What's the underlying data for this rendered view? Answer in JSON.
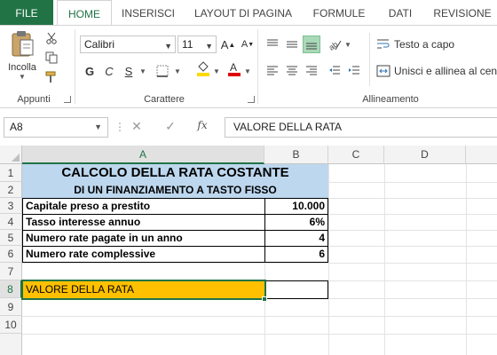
{
  "ribbon": {
    "tabs": [
      "FILE",
      "HOME",
      "INSERISCI",
      "LAYOUT DI PAGINA",
      "FORMULE",
      "DATI",
      "REVISIONE"
    ],
    "clipboard": {
      "paste_label": "Incolla",
      "group_label": "Appunti"
    },
    "font": {
      "name": "Calibri",
      "size": "11",
      "group_label": "Carattere",
      "bold": "G",
      "italic": "C",
      "underline": "S",
      "grow": "A",
      "shrink": "A"
    },
    "alignment": {
      "wrap_text": "Testo a capo",
      "merge_center": "Unisci e allinea al cent",
      "group_label": "Allineamento"
    }
  },
  "formula_bar": {
    "name_box": "A8",
    "formula": "VALORE DELLA RATA",
    "fx": "fx"
  },
  "sheet": {
    "columns": [
      "A",
      "B",
      "C",
      "D"
    ],
    "rows": [
      "1",
      "2",
      "3",
      "4",
      "5",
      "6",
      "7",
      "8",
      "9",
      "10"
    ],
    "title": "CALCOLO DELLA RATA COSTANTE",
    "subtitle": "DI UN FINANZIAMENTO A TASTO FISSO",
    "items": [
      {
        "label": "Capitale preso a prestito",
        "value": "10.000"
      },
      {
        "label": "Tasso interesse annuo",
        "value": "6%"
      },
      {
        "label": "Numero rate pagate in un anno",
        "value": "4"
      },
      {
        "label": "Numero rate complessive",
        "value": "6"
      }
    ],
    "result_label": "VALORE DELLA RATA",
    "result_value": ""
  },
  "colors": {
    "accent": "#217346",
    "title_fill": "#BDD7EE",
    "result_fill": "#FFC000"
  }
}
